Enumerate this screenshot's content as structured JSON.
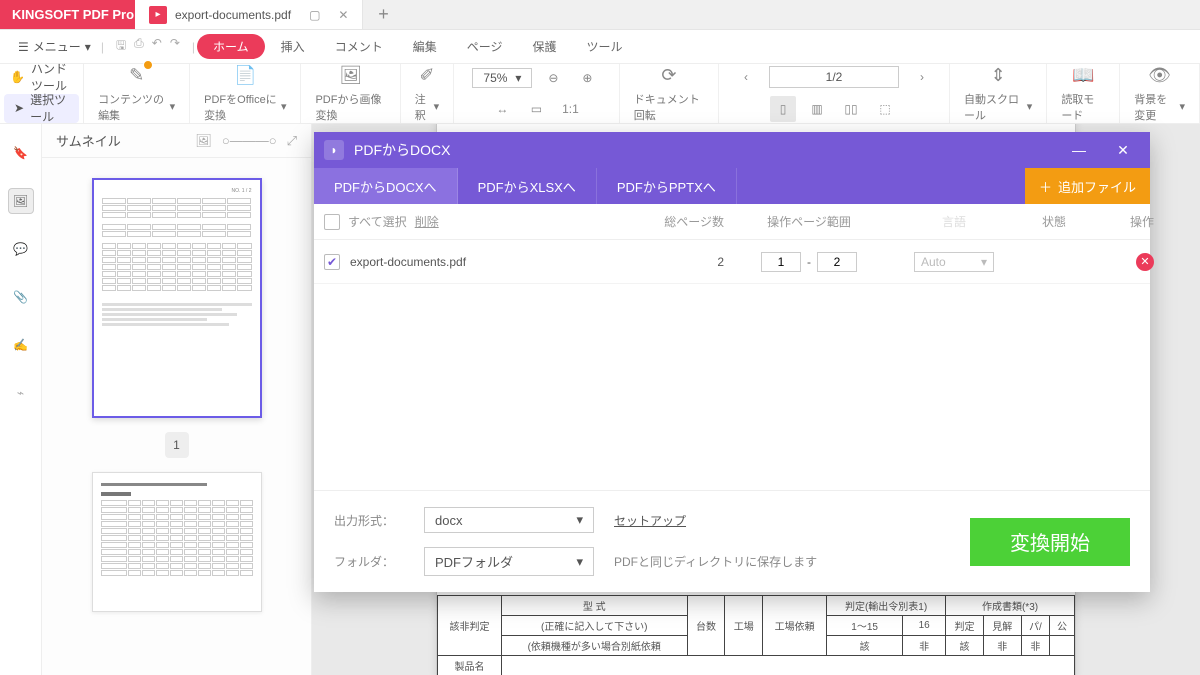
{
  "app": {
    "brand": "KINGSOFT PDF Pro"
  },
  "tab": {
    "filename": "export-documents.pdf"
  },
  "menu": {
    "label": "メニュー",
    "items": [
      "挿入",
      "コメント",
      "編集",
      "ページ",
      "保護",
      "ツール"
    ],
    "home": "ホーム"
  },
  "tools": {
    "hand": "ハンドツール",
    "select": "選択ツール",
    "edit_content": "コンテンツの編集",
    "to_office": "PDFをOfficeに変換",
    "to_image": "PDFから画像変換",
    "annotate": "注釈",
    "zoom": "75%",
    "rotate": "ドキュメント回転",
    "page": "1/2",
    "autoscroll": "自動スクロール",
    "read_mode": "読取モード",
    "bg_change": "背景を変更"
  },
  "sidebar": {
    "title": "サムネイル",
    "page1": "1"
  },
  "modal": {
    "title": "PDFからDOCX",
    "tabs": [
      "PDFからDOCXへ",
      "PDFからXLSXへ",
      "PDFからPPTXへ"
    ],
    "add_file": "追加ファイル",
    "columns": {
      "select_all": "すべて選択",
      "delete": "削除",
      "pages_total": "総ページ数",
      "page_range": "操作ページ範囲",
      "language": "言語",
      "status": "状態",
      "action": "操作"
    },
    "row": {
      "filename": "export-documents.pdf",
      "pages": "2",
      "from": "1",
      "to": "2",
      "lang": "Auto"
    },
    "footer": {
      "format_label": "出力形式：",
      "format_value": "docx",
      "setup": "セットアップ",
      "folder_label": "フォルダ：",
      "folder_value": "PDFフォルダ",
      "note": "PDFと同じディレクトリに保存します",
      "go": "変換開始"
    }
  },
  "doc": {
    "r1c1": "該非判定",
    "r1c2": "型 式",
    "r1c3": "台数",
    "r1c4": "工場",
    "r1c5": "工場依頼",
    "r1c6": "判定(輸出令別表1)",
    "r1c7": "作成書類(*3)",
    "r2a": "(正確に記入して下さい)",
    "r2b": "(依頼機種が多い場合別紙依頼",
    "r3a": "製品名",
    "s1": "1～15",
    "s2": "16",
    "s3": "判定",
    "s4": "見解",
    "s5": "パ/",
    "s6": "公",
    "t1": "該",
    "t2": "非",
    "t3": "該",
    "t4": "非",
    "t5": "非"
  }
}
